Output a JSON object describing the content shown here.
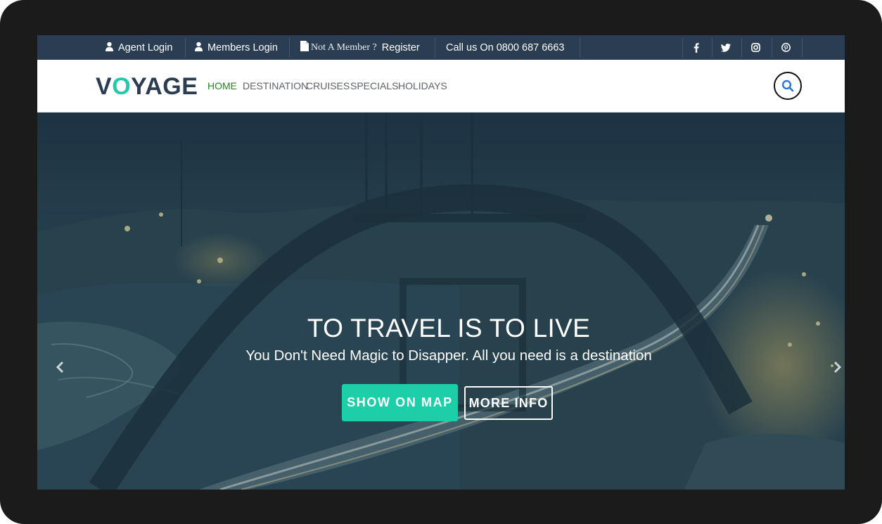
{
  "topbar": {
    "agent_login": "Agent Login",
    "members_login": "Members Login",
    "not_member": "Not A Member ?",
    "register": "Register",
    "call_us": "Call us On 0800 687 6663",
    "social": [
      "facebook-icon",
      "twitter-icon",
      "instagram-icon",
      "pinterest-icon"
    ]
  },
  "navbar": {
    "logo_parts": [
      "V",
      "O",
      "YAGE"
    ],
    "links": [
      "HOME",
      "DESTINATION",
      "CRUISES",
      "SPECIALS",
      "HOLIDAYS"
    ],
    "active": "HOME"
  },
  "hero": {
    "title": "TO TRAVEL IS TO LIVE",
    "subtitle": "You Don't Need Magic to Disapper. All you need is a destination",
    "primary_button": "SHOW ON MAP",
    "secondary_button": "MORE INFO"
  },
  "colors": {
    "topbar_bg": "#2a3d52",
    "accent_teal": "#1ccfa9",
    "logo_text": "#2b3d52",
    "nav_active": "#1f8a1f",
    "frame": "#1b1b1b"
  }
}
